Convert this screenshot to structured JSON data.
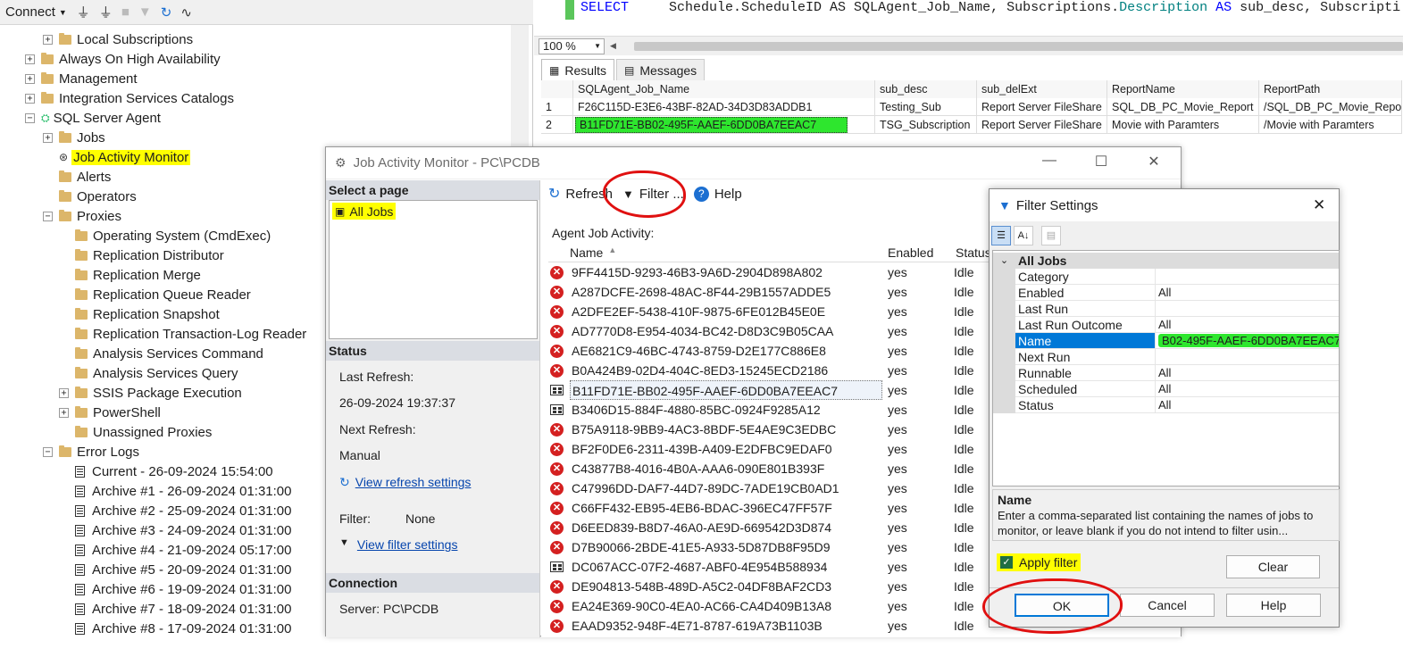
{
  "oe": {
    "toolbar": {
      "connect": "Connect"
    },
    "tree": [
      {
        "label": "Local Subscriptions",
        "exp": "+",
        "icon": "folder",
        "indent": 48
      },
      {
        "label": "Always On High Availability",
        "exp": "+",
        "icon": "folder",
        "indent": 28
      },
      {
        "label": "Management",
        "exp": "+",
        "icon": "folder",
        "indent": 28
      },
      {
        "label": "Integration Services Catalogs",
        "exp": "+",
        "icon": "folder",
        "indent": 28
      },
      {
        "label": "SQL Server Agent",
        "exp": "−",
        "icon": "agent",
        "indent": 28
      },
      {
        "label": "Jobs",
        "exp": "+",
        "icon": "folder",
        "indent": 48
      },
      {
        "label": "Job Activity Monitor",
        "exp": "",
        "icon": "jam",
        "indent": 48,
        "hl": true
      },
      {
        "label": "Alerts",
        "exp": "",
        "icon": "folder",
        "indent": 48
      },
      {
        "label": "Operators",
        "exp": "",
        "icon": "folder",
        "indent": 48
      },
      {
        "label": "Proxies",
        "exp": "−",
        "icon": "folder",
        "indent": 48
      },
      {
        "label": "Operating System (CmdExec)",
        "exp": "",
        "icon": "folder",
        "indent": 66
      },
      {
        "label": "Replication Distributor",
        "exp": "",
        "icon": "folder",
        "indent": 66
      },
      {
        "label": "Replication Merge",
        "exp": "",
        "icon": "folder",
        "indent": 66
      },
      {
        "label": "Replication Queue Reader",
        "exp": "",
        "icon": "folder",
        "indent": 66
      },
      {
        "label": "Replication Snapshot",
        "exp": "",
        "icon": "folder",
        "indent": 66
      },
      {
        "label": "Replication Transaction-Log Reader",
        "exp": "",
        "icon": "folder",
        "indent": 66
      },
      {
        "label": "Analysis Services Command",
        "exp": "",
        "icon": "folder",
        "indent": 66
      },
      {
        "label": "Analysis Services Query",
        "exp": "",
        "icon": "folder",
        "indent": 66
      },
      {
        "label": "SSIS Package Execution",
        "exp": "+",
        "icon": "folder",
        "indent": 66
      },
      {
        "label": "PowerShell",
        "exp": "+",
        "icon": "folder",
        "indent": 66
      },
      {
        "label": "Unassigned Proxies",
        "exp": "",
        "icon": "folder",
        "indent": 66
      },
      {
        "label": "Error Logs",
        "exp": "−",
        "icon": "folder",
        "indent": 48
      },
      {
        "label": "Current - 26-09-2024 15:54:00",
        "exp": "",
        "icon": "doc",
        "indent": 66
      },
      {
        "label": "Archive #1 - 26-09-2024 01:31:00",
        "exp": "",
        "icon": "doc",
        "indent": 66
      },
      {
        "label": "Archive #2 - 25-09-2024 01:31:00",
        "exp": "",
        "icon": "doc",
        "indent": 66
      },
      {
        "label": "Archive #3 - 24-09-2024 01:31:00",
        "exp": "",
        "icon": "doc",
        "indent": 66
      },
      {
        "label": "Archive #4 - 21-09-2024 05:17:00",
        "exp": "",
        "icon": "doc",
        "indent": 66
      },
      {
        "label": "Archive #5 - 20-09-2024 01:31:00",
        "exp": "",
        "icon": "doc",
        "indent": 66
      },
      {
        "label": "Archive #6 - 19-09-2024 01:31:00",
        "exp": "",
        "icon": "doc",
        "indent": 66
      },
      {
        "label": "Archive #7 - 18-09-2024 01:31:00",
        "exp": "",
        "icon": "doc",
        "indent": 66
      },
      {
        "label": "Archive #8 - 17-09-2024 01:31:00",
        "exp": "",
        "icon": "doc",
        "indent": 66
      }
    ]
  },
  "editor": {
    "keyword": "SELECT",
    "rest": "     Schedule.ScheduleID AS SQLAgent_Job_Name, Subscriptions.",
    "desc": "Description",
    "as": " AS",
    "tail": " sub_desc, Subscripti",
    "zoom": "100 %"
  },
  "tabs": {
    "results": "Results",
    "messages": "Messages"
  },
  "grid": {
    "headers": [
      "SQLAgent_Job_Name",
      "sub_desc",
      "sub_delExt",
      "ReportName",
      "ReportPath"
    ],
    "rows": [
      {
        "num": "1",
        "cells": [
          "F26C115D-E3E6-43BF-82AD-34D3D83ADDB1",
          "Testing_Sub",
          "Report Server FileShare",
          "SQL_DB_PC_Movie_Report",
          "/SQL_DB_PC_Movie_Report"
        ]
      },
      {
        "num": "2",
        "cells": [
          "B11FD71E-BB02-495F-AAEF-6DD0BA7EEAC7",
          "TSG_Subscription",
          "Report Server FileShare",
          "Movie with Paramters",
          "/Movie with Paramters"
        ]
      }
    ]
  },
  "jam": {
    "title": "Job Activity Monitor - PC\\PCDB",
    "select_page": "Select a page",
    "all_jobs": "All Jobs",
    "status_hdr": "Status",
    "last_refresh_label": "Last Refresh:",
    "last_refresh": "26-09-2024 19:37:37",
    "next_refresh_label": "Next Refresh:",
    "next_refresh": "Manual",
    "view_refresh": "View refresh settings",
    "filter_label": "Filter:",
    "filter_val": "None",
    "view_filter": "View filter settings",
    "connection_hdr": "Connection",
    "server": "Server: PC\\PCDB",
    "refresh": "Refresh",
    "filter": "Filter ...",
    "help": "Help",
    "agent_activity": "Agent Job Activity:",
    "col_name": "Name",
    "col_enabled": "Enabled",
    "col_status": "Status",
    "jobs": [
      {
        "name": "9FF4415D-9293-46B3-9A6D-2904D898A802",
        "icon": "err",
        "enabled": "yes",
        "status": "Idle"
      },
      {
        "name": "A287DCFE-2698-48AC-8F44-29B1557ADDE5",
        "icon": "err",
        "enabled": "yes",
        "status": "Idle"
      },
      {
        "name": "A2DFE2EF-5438-410F-9875-6FE012B45E0E",
        "icon": "err",
        "enabled": "yes",
        "status": "Idle"
      },
      {
        "name": "AD7770D8-E954-4034-BC42-D8D3C9B05CAA",
        "icon": "err",
        "enabled": "yes",
        "status": "Idle"
      },
      {
        "name": "AE6821C9-46BC-4743-8759-D2E177C886E8",
        "icon": "err",
        "enabled": "yes",
        "status": "Idle"
      },
      {
        "name": "B0A424B9-02D4-404C-8ED3-15245ECD2186",
        "icon": "err",
        "enabled": "yes",
        "status": "Idle"
      },
      {
        "name": "B11FD71E-BB02-495F-AAEF-6DD0BA7EEAC7",
        "icon": "job",
        "enabled": "yes",
        "status": "Idle",
        "sel": true
      },
      {
        "name": "B3406D15-884F-4880-85BC-0924F9285A12",
        "icon": "job",
        "enabled": "yes",
        "status": "Idle"
      },
      {
        "name": "B75A9118-9BB9-4AC3-8BDF-5E4AE9C3EDBC",
        "icon": "err",
        "enabled": "yes",
        "status": "Idle"
      },
      {
        "name": "BF2F0DE6-2311-439B-A409-E2DFBC9EDAF0",
        "icon": "err",
        "enabled": "yes",
        "status": "Idle"
      },
      {
        "name": "C43877B8-4016-4B0A-AAA6-090E801B393F",
        "icon": "err",
        "enabled": "yes",
        "status": "Idle"
      },
      {
        "name": "C47996DD-DAF7-44D7-89DC-7ADE19CB0AD1",
        "icon": "err",
        "enabled": "yes",
        "status": "Idle"
      },
      {
        "name": "C66FF432-EB95-4EB6-BDAC-396EC47FF57F",
        "icon": "err",
        "enabled": "yes",
        "status": "Idle"
      },
      {
        "name": "D6EED839-B8D7-46A0-AE9D-669542D3D874",
        "icon": "err",
        "enabled": "yes",
        "status": "Idle"
      },
      {
        "name": "D7B90066-2BDE-41E5-A933-5D87DB8F95D9",
        "icon": "err",
        "enabled": "yes",
        "status": "Idle"
      },
      {
        "name": "DC067ACC-07F2-4687-ABF0-4E954B588934",
        "icon": "job",
        "enabled": "yes",
        "status": "Idle"
      },
      {
        "name": "DE904813-548B-489D-A5C2-04DF8BAF2CD3",
        "icon": "err",
        "enabled": "yes",
        "status": "Idle"
      },
      {
        "name": "EA24E369-90C0-4EA0-AC66-CA4D409B13A8",
        "icon": "err",
        "enabled": "yes",
        "status": "Idle"
      },
      {
        "name": "EAAD9352-948F-4E71-8787-619A73B1103B",
        "icon": "err",
        "enabled": "yes",
        "status": "Idle"
      }
    ]
  },
  "filter": {
    "title": "Filter Settings",
    "category": "All Jobs",
    "props": [
      {
        "name": "Category",
        "value": ""
      },
      {
        "name": "Enabled",
        "value": "All"
      },
      {
        "name": "Last Run",
        "value": ""
      },
      {
        "name": "Last Run Outcome",
        "value": "All"
      },
      {
        "name": "Name",
        "value": "B02-495F-AAEF-6DD0BA7EEAC7",
        "sel": true
      },
      {
        "name": "Next Run",
        "value": ""
      },
      {
        "name": "Runnable",
        "value": "All"
      },
      {
        "name": "Scheduled",
        "value": "All"
      },
      {
        "name": "Status",
        "value": "All"
      }
    ],
    "desc_title": "Name",
    "desc_text": "Enter a comma-separated list containing the names of jobs to monitor, or leave blank if you do not intend to filter usin...",
    "apply_filter": "Apply filter",
    "clear": "Clear",
    "ok": "OK",
    "cancel": "Cancel",
    "help": "Help"
  }
}
